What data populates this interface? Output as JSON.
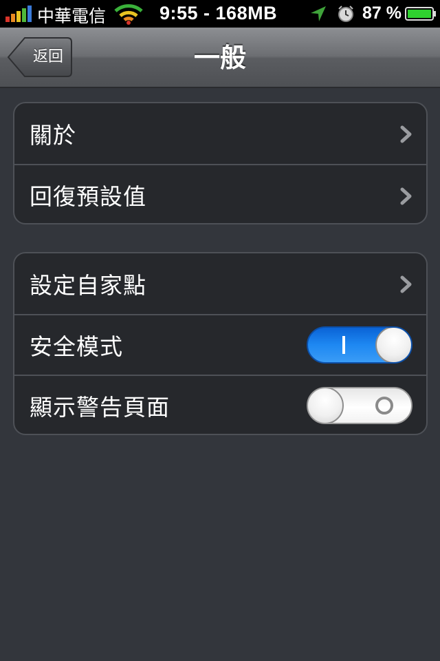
{
  "status_bar": {
    "carrier": "中華電信",
    "time": "9:55 - 168MB",
    "battery_percent": "87 %",
    "icons": [
      "signal-bars-icon",
      "wifi-icon",
      "location-arrow-icon",
      "alarm-clock-icon",
      "battery-icon"
    ]
  },
  "nav": {
    "back_label": "返回",
    "title": "一般"
  },
  "groups": [
    {
      "rows": [
        {
          "label": "關於",
          "accessory": "chevron"
        },
        {
          "label": "回復預設值",
          "accessory": "chevron"
        }
      ]
    },
    {
      "rows": [
        {
          "label": "設定自家點",
          "accessory": "chevron"
        },
        {
          "label": "安全模式",
          "accessory": "switch",
          "on": true
        },
        {
          "label": "顯示警告頁面",
          "accessory": "switch",
          "on": false
        }
      ]
    }
  ],
  "colors": {
    "background": "#33363c",
    "group_fill": "#26282c",
    "switch_on": "#1e88f2"
  }
}
